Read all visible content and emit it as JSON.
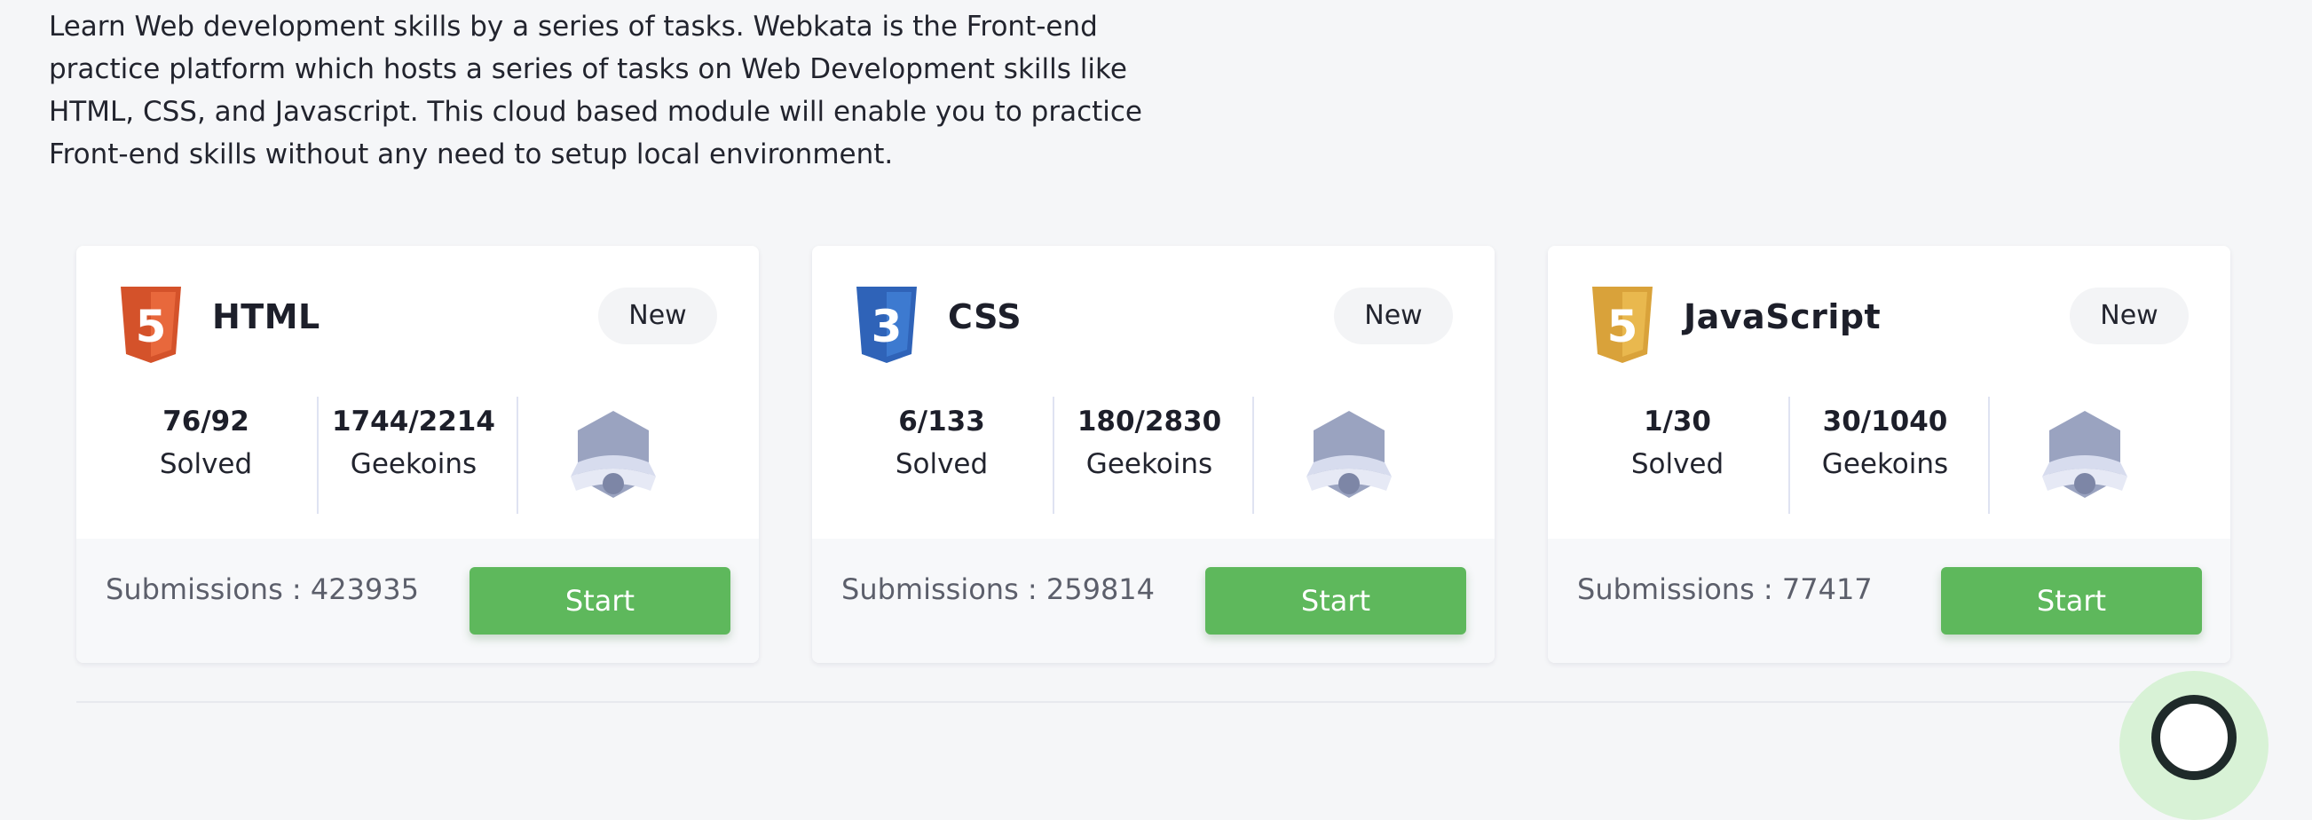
{
  "intro": {
    "text": "Learn Web development skills by a series of tasks. Webkata is the Front-end practice platform which hosts a series of tasks on Web Development skills like HTML, CSS, and Javascript. This cloud based module will enable you to practice Front-end skills without any need to setup local environment."
  },
  "cards": [
    {
      "name": "HTML",
      "badge": "New",
      "logo_icon": "html5-icon",
      "logo_color": "#e34f26",
      "logo_digit": "5",
      "solved_value": "76/92",
      "solved_label": "Solved",
      "geekoins_value": "1744/2214",
      "geekoins_label": "Geekoins",
      "medal_icon": "medal-icon",
      "submissions": "Submissions : 423935",
      "start_label": "Start"
    },
    {
      "name": "CSS",
      "badge": "New",
      "logo_icon": "css3-icon",
      "logo_color": "#2965f1",
      "logo_digit": "3",
      "solved_value": "6/133",
      "solved_label": "Solved",
      "geekoins_value": "180/2830",
      "geekoins_label": "Geekoins",
      "medal_icon": "medal-icon",
      "submissions": "Submissions : 259814",
      "start_label": "Start"
    },
    {
      "name": "JavaScript",
      "badge": "New",
      "logo_icon": "javascript-icon",
      "logo_color": "#e2a83c",
      "logo_digit": "5",
      "solved_value": "1/30",
      "solved_label": "Solved",
      "geekoins_value": "30/1040",
      "geekoins_label": "Geekoins",
      "medal_icon": "medal-icon",
      "submissions": "Submissions : 77417",
      "start_label": "Start"
    }
  ],
  "colors": {
    "background": "#f5f6f8",
    "card": "#ffffff",
    "card_footer": "#f7f8fa",
    "start_button": "#5eb85c",
    "badge_bg": "#f3f4f6",
    "divider": "#dfe3f2",
    "medal": "#9aa3c0"
  },
  "chat_widget": {
    "icon": "chat-icon"
  }
}
